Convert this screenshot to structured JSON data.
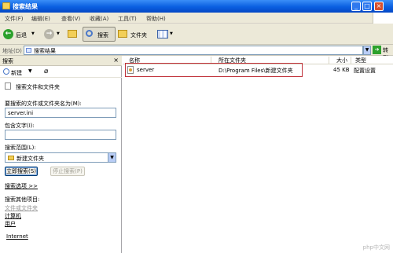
{
  "window": {
    "title": "搜索结果",
    "controls": [
      "_",
      "□",
      "×"
    ]
  },
  "menu": [
    "文件(F)",
    "编辑(E)",
    "查看(V)",
    "收藏(A)",
    "工具(T)",
    "帮助(H)"
  ],
  "toolbar": {
    "back": "后退",
    "search": "搜索",
    "folders": "文件夹"
  },
  "address": {
    "label": "地址(D)",
    "value": "搜索结果",
    "go": "转到"
  },
  "search_pane": {
    "title": "搜索",
    "new": "新建",
    "panel_title": "搜索文件和文件夹",
    "name_label": "要搜索的文件或文件夹名为(M):",
    "name_value": "server.ini",
    "text_label": "包含文字(I):",
    "text_value": "",
    "scope_label": "搜索范围(L):",
    "scope_value": "新建文件夹",
    "search_now": "立即搜索(S)",
    "stop": "停止搜索(P)",
    "options": "搜索选项 >>",
    "other_label": "搜索其他项目:",
    "other_items": [
      "文件或文件夹",
      "计算机",
      "用户"
    ],
    "internet": "Internet"
  },
  "results": {
    "columns": [
      "名称",
      "所在文件夹",
      "大小",
      "类型"
    ],
    "rows": [
      {
        "name": "server",
        "folder": "D:\\Program Files\\新建文件夹",
        "size": "45 KB",
        "type": "配置设置"
      }
    ]
  },
  "watermark": "php中文网"
}
